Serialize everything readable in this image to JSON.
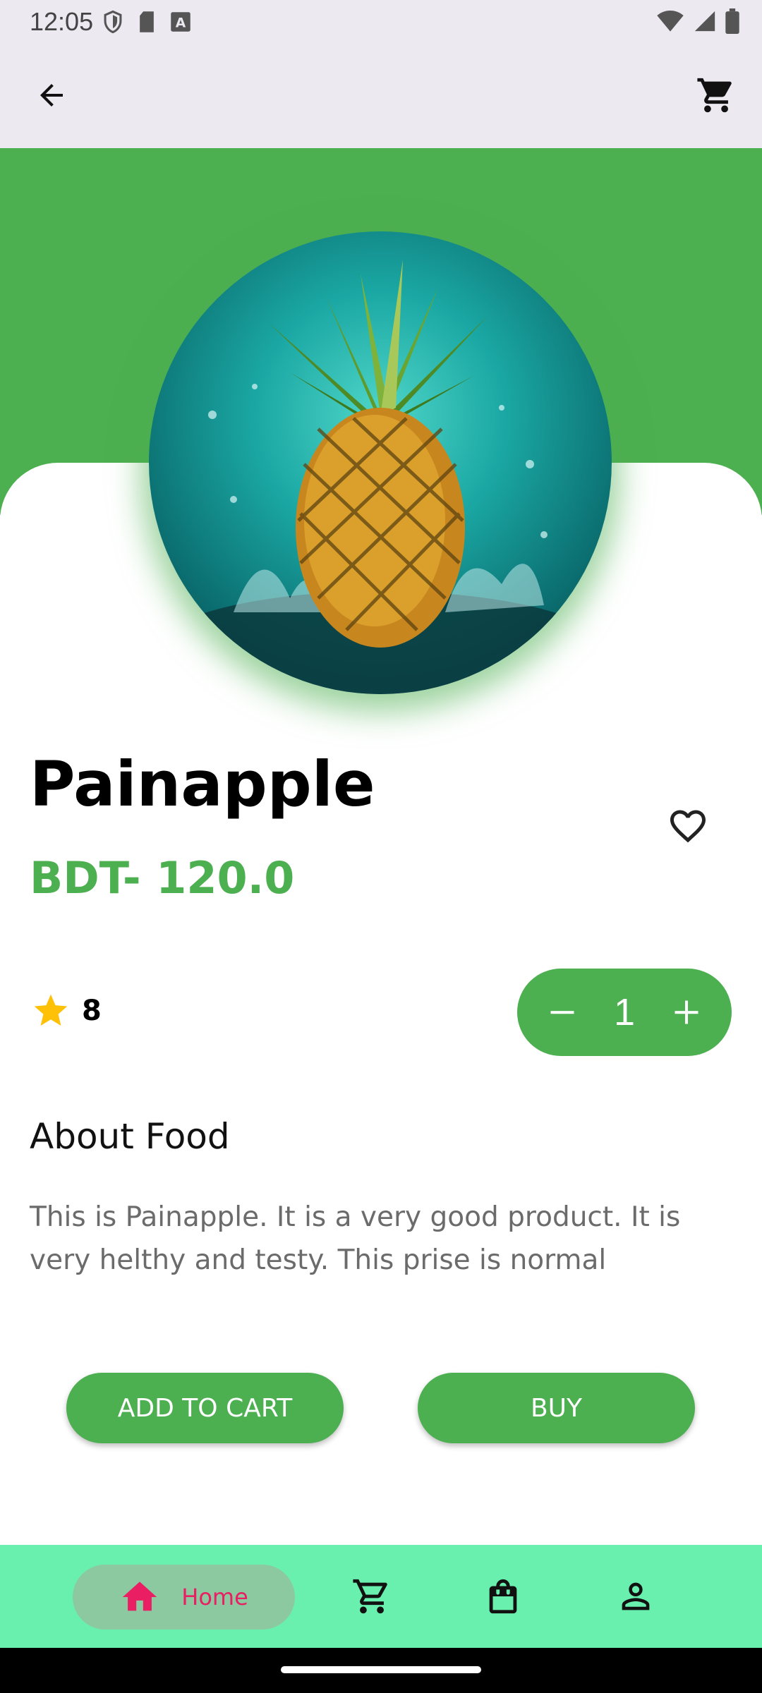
{
  "status_bar": {
    "time": "12:05",
    "left_icons": [
      "shield-icon",
      "sd-card-icon",
      "keyboard-a-icon"
    ],
    "right_icons": [
      "wifi-icon",
      "signal-icon",
      "battery-icon"
    ]
  },
  "app_bar": {
    "back_icon": "arrow-back-icon",
    "cart_icon": "cart-icon"
  },
  "product": {
    "name": "Painapple",
    "price": "BDT- 120.0",
    "rating": "8",
    "quantity": "1",
    "about_title": "About Food",
    "description": "This is Painapple. It is a very good product. It is very helthy and testy. This prise is normal"
  },
  "actions": {
    "add_to_cart": "ADD TO CART",
    "buy": "BUY"
  },
  "bottom_nav": {
    "items": [
      {
        "label": "Home",
        "icon": "home-icon",
        "selected": true
      },
      {
        "label": "",
        "icon": "cart-icon"
      },
      {
        "label": "",
        "icon": "shopping-bag-icon"
      },
      {
        "label": "",
        "icon": "person-icon"
      }
    ]
  },
  "colors": {
    "primary_green": "#4caf50",
    "nav_background": "#69f0ae",
    "selected_accent": "#e91e63",
    "app_bar_background": "#ece9f1",
    "star": "#ffc107"
  }
}
